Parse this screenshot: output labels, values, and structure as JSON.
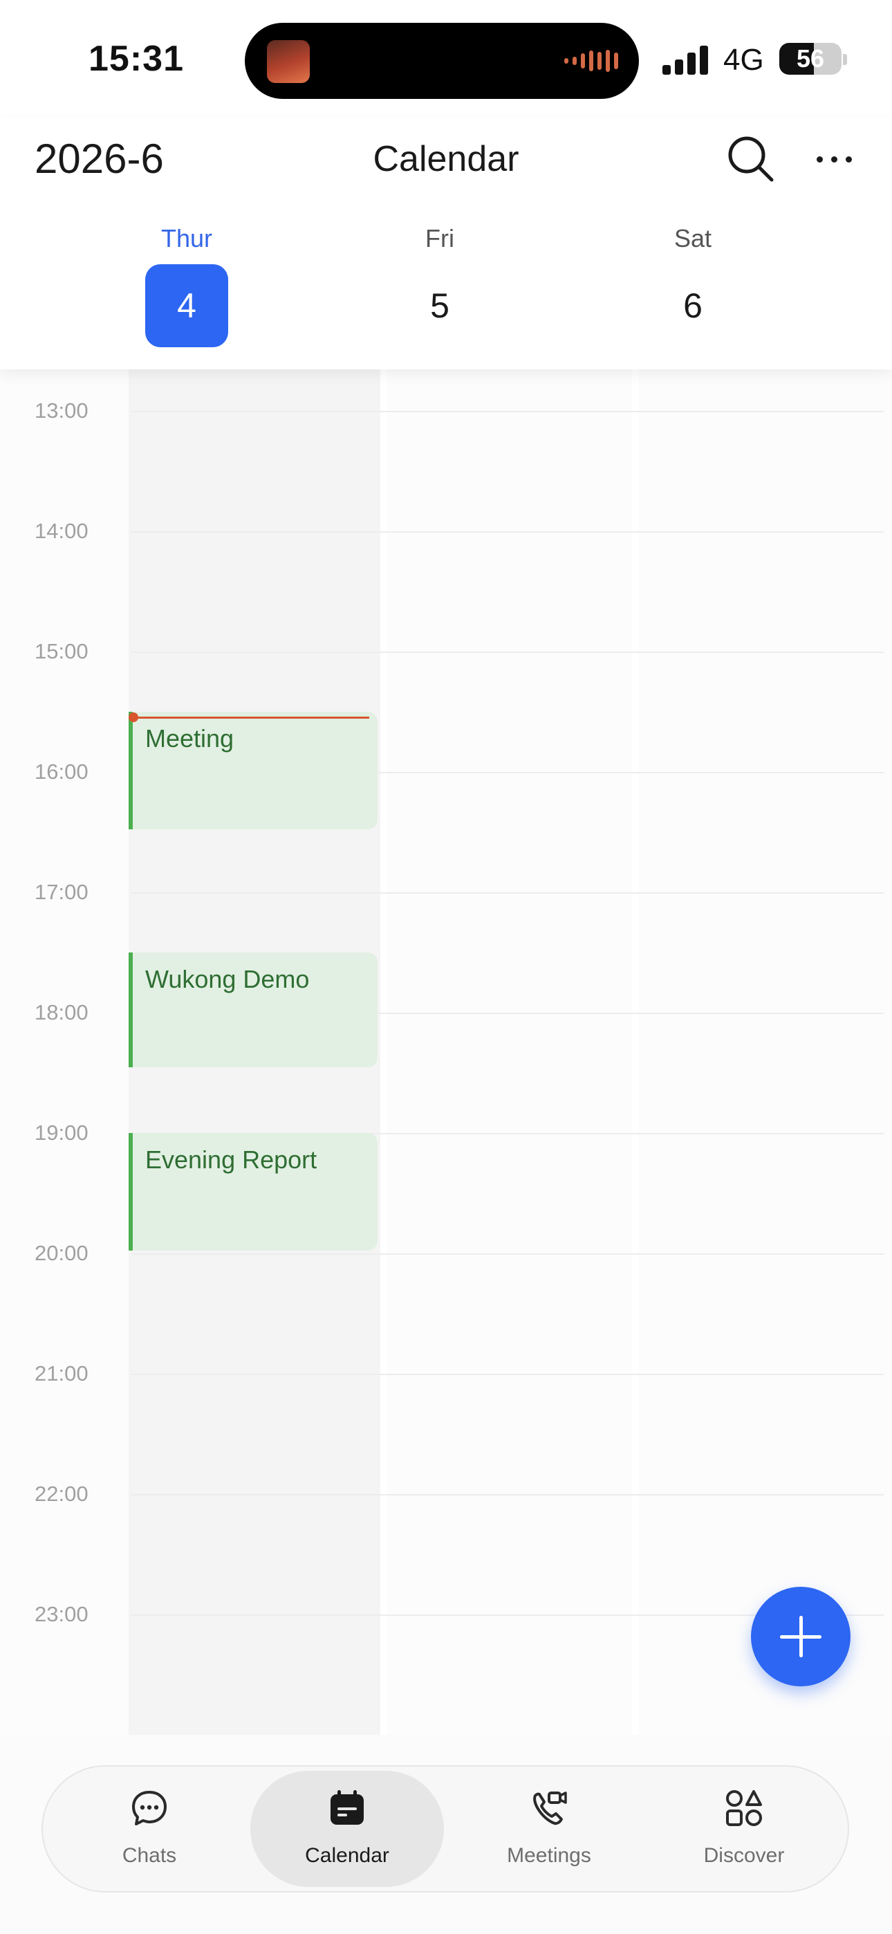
{
  "status_bar": {
    "time": "15:31",
    "network": "4G",
    "battery": "56"
  },
  "header": {
    "month": "2026-6",
    "title": "Calendar",
    "icons": {
      "search": "search-icon",
      "more": "more-icon"
    }
  },
  "days": [
    {
      "dow": "Thur",
      "date": "4",
      "selected": true
    },
    {
      "dow": "Fri",
      "date": "5",
      "selected": false
    },
    {
      "dow": "Sat",
      "date": "6",
      "selected": false
    }
  ],
  "hours": [
    "13:00",
    "14:00",
    "15:00",
    "16:00",
    "17:00",
    "18:00",
    "19:00",
    "20:00",
    "21:00",
    "22:00",
    "23:00"
  ],
  "events": [
    {
      "title": "Meeting",
      "start": "15:30",
      "end": "16:30"
    },
    {
      "title": "Wukong Demo",
      "start": "17:30",
      "end": "18:30"
    },
    {
      "title": "Evening Report",
      "start": "19:00",
      "end": "20:00"
    }
  ],
  "now": "15:31",
  "fab": {
    "icon": "plus-icon"
  },
  "tabs": [
    {
      "label": "Chats",
      "icon": "chat-icon",
      "active": false
    },
    {
      "label": "Calendar",
      "icon": "calendar-icon",
      "active": true
    },
    {
      "label": "Meetings",
      "icon": "meeting-icon",
      "active": false
    },
    {
      "label": "Discover",
      "icon": "discover-icon",
      "active": false
    }
  ],
  "colors": {
    "accent": "#2c66f2",
    "event_bg": "#e2f0e3",
    "event_bar": "#4caf50",
    "event_text": "#2f6e33",
    "now_line": "#d8552e"
  }
}
